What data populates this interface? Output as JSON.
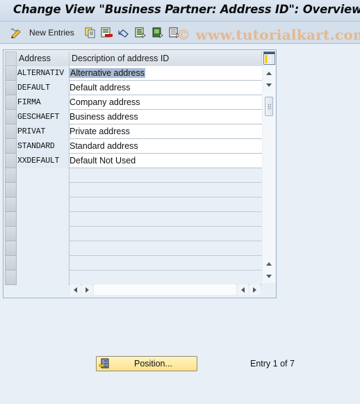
{
  "window": {
    "title": "Change View \"Business Partner: Address ID\": Overview"
  },
  "toolbar": {
    "new_entries_label": "New Entries",
    "icons": [
      "edit-pencil-icon",
      "copy-icon",
      "delete-icon",
      "undo-icon",
      "select-all-icon",
      "select-block-icon",
      "deselect-all-icon"
    ],
    "watermark": "© www.tutorialkart.com"
  },
  "table": {
    "columns": [
      {
        "label": "Address"
      },
      {
        "label": "Description of address ID"
      }
    ],
    "rows": [
      {
        "address": "ALTERNATIV",
        "description": "Alternative address",
        "selected": true
      },
      {
        "address": "DEFAULT",
        "description": "Default address"
      },
      {
        "address": "FIRMA",
        "description": "Company address"
      },
      {
        "address": "GESCHAEFT",
        "description": "Business address"
      },
      {
        "address": "PRIVAT",
        "description": "Private address"
      },
      {
        "address": "STANDARD",
        "description": "Standard address"
      },
      {
        "address": "XXDEFAULT",
        "description": "Default Not Used"
      }
    ],
    "empty_rows": 8
  },
  "footer": {
    "position_button_label": "Position...",
    "entry_info": "Entry 1 of 7"
  },
  "colors": {
    "selection": "#a9bcd4",
    "position_button": "#fbe38b",
    "watermark": "#e8b78c"
  }
}
